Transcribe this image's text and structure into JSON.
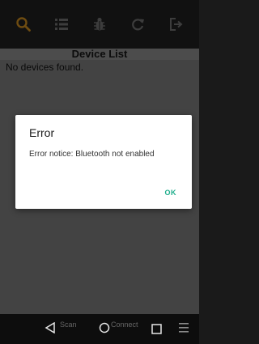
{
  "toolbar": {
    "icons": [
      "search-icon",
      "list-icon",
      "bug-icon",
      "refresh-icon",
      "exit-icon"
    ],
    "colors": {
      "search": "#c98a1f",
      "list": "#6f6f6f",
      "bug": "#6f6f6f",
      "refresh": "#6f6f6f",
      "exit": "#6f6f6f"
    }
  },
  "header": {
    "title": "Device List"
  },
  "content": {
    "empty_message": "No devices found."
  },
  "dialog": {
    "title": "Error",
    "message": "Error notice: Bluetooth not enabled",
    "ok_label": "OK",
    "ok_color": "#1fae8c"
  },
  "navbar": {
    "scan_label": "Scan",
    "connect_label": "Connect",
    "icons": [
      "back-icon",
      "home-icon",
      "recent-apps-icon",
      "menu-icon"
    ]
  }
}
